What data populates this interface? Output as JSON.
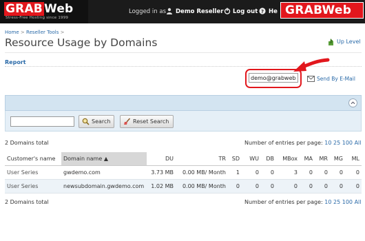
{
  "header": {
    "logo_grab": "GRAB",
    "logo_web": "Web",
    "tagline": "Stress-Free Hosting since 1999",
    "logged_in_as": "Logged in as",
    "user_name": "Demo Reseller",
    "logout_label": "Log out",
    "help_label": "He",
    "watermark_grab": "GRAB",
    "watermark_web": "Web",
    "colors": {
      "brand_red": "#e2171d",
      "bar": "#1b1b1b"
    }
  },
  "breadcrumb": {
    "home": "Home",
    "separator": ">",
    "reseller_tools": "Reseller Tools",
    "trailing": ">"
  },
  "page": {
    "title": "Resource Usage by Domains",
    "up_level": "Up Level"
  },
  "report": {
    "label": "Report",
    "email_value": "demo@grabweb.r",
    "send_label": "Send By E-Mail"
  },
  "search": {
    "input_value": "",
    "search_button": "Search",
    "reset_button": "Reset Search"
  },
  "summary": {
    "total_top": "2 Domains total",
    "total_bottom": "2 Domains total",
    "per_page_label": "Number of entries per page:",
    "per_page_options": [
      "10",
      "25",
      "100",
      "All"
    ]
  },
  "table": {
    "columns": [
      "Customer's name",
      "Domain name",
      "DU",
      "TR",
      "SD",
      "WU",
      "DB",
      "MBox",
      "MA",
      "MR",
      "MG",
      "ML"
    ],
    "sort_indicator": "▲",
    "rows": [
      {
        "customer": "User Series",
        "domain": "gwdemo.com",
        "du": "3.73 MB",
        "tr": "0.00 MB/ Month",
        "sd": "1",
        "wu": "0",
        "db": "0",
        "mbox": "3",
        "ma": "0",
        "mr": "0",
        "mg": "0",
        "ml": "0"
      },
      {
        "customer": "User Series",
        "domain": "newsubdomain.gwdemo.com",
        "du": "1.02 MB",
        "tr": "0.00 MB/ Month",
        "sd": "0",
        "wu": "0",
        "db": "0",
        "mbox": "0",
        "ma": "0",
        "mr": "0",
        "mg": "0",
        "ml": "0"
      }
    ]
  }
}
